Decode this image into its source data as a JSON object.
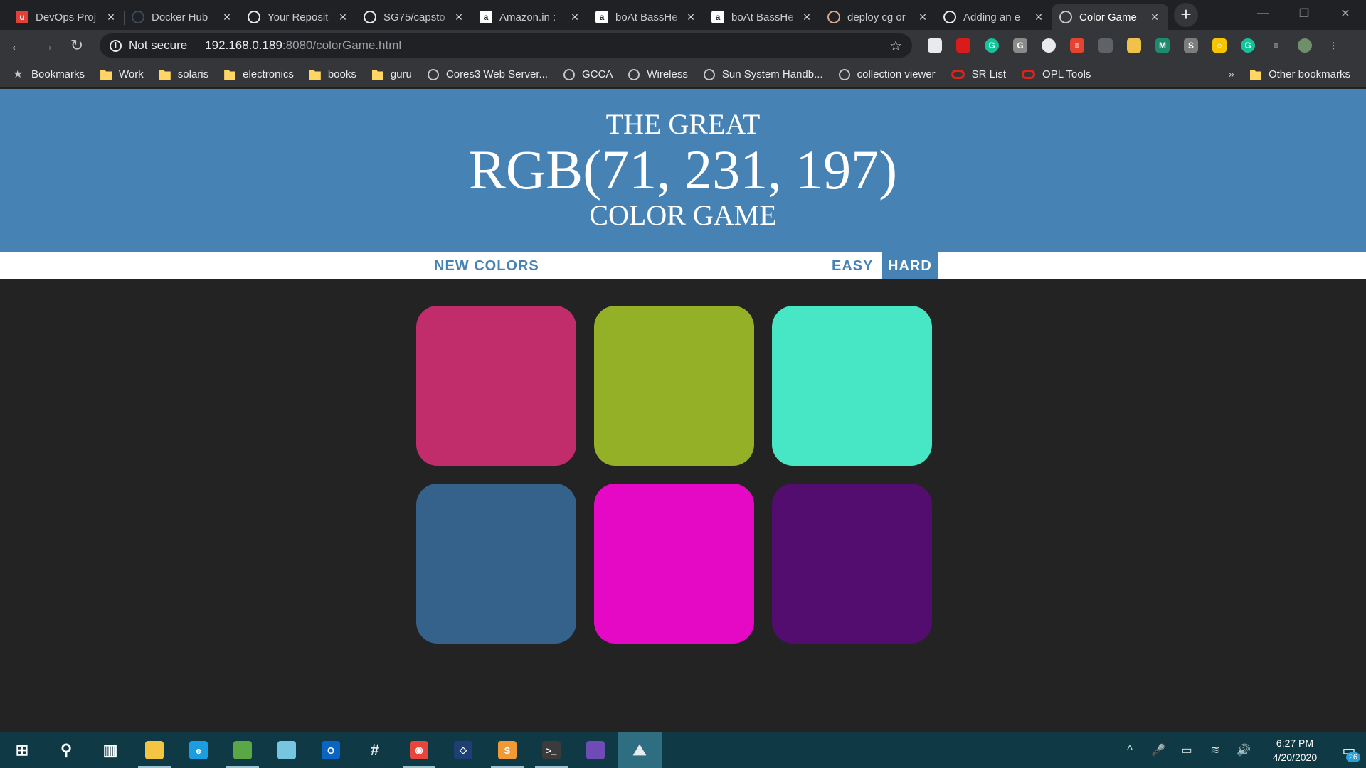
{
  "browser": {
    "tabs": [
      {
        "title": "DevOps Proj",
        "icon": "devops-icon",
        "color": "#e4403a",
        "glyph": "u"
      },
      {
        "title": "Docker Hub",
        "icon": "docker-icon",
        "color": "#3a4a5a",
        "glyph": ""
      },
      {
        "title": "Your Reposit",
        "icon": "github-icon",
        "color": "#e8eaed",
        "glyph": ""
      },
      {
        "title": "SG75/capsto",
        "icon": "github-icon",
        "color": "#e8eaed",
        "glyph": ""
      },
      {
        "title": "Amazon.in :",
        "icon": "amazon-icon",
        "color": "#ffffff",
        "glyph": "a"
      },
      {
        "title": "boAt BassHe",
        "icon": "amazon-icon",
        "color": "#ffffff",
        "glyph": "a"
      },
      {
        "title": "boAt BassHe",
        "icon": "amazon-icon",
        "color": "#ffffff",
        "glyph": "a"
      },
      {
        "title": "deploy cg or",
        "icon": "avatar-icon",
        "color": "#d9a78a",
        "glyph": ""
      },
      {
        "title": "Adding an e",
        "icon": "github-icon",
        "color": "#e8eaed",
        "glyph": ""
      },
      {
        "title": "Color Game",
        "icon": "globe-icon",
        "color": "#c4c6c9",
        "glyph": "",
        "active": true
      }
    ],
    "new_tab": "+",
    "window_controls": [
      "—",
      "❐",
      "✕"
    ],
    "nav": {
      "back": "←",
      "forward": "→",
      "reload": "↻"
    },
    "address": {
      "security": "Not secure",
      "host": "192.168.0.189",
      "path": ":8080/colorGame.html",
      "bookmark_star": "☆"
    },
    "extensions": [
      {
        "icon": "shield-ext-icon",
        "color": "#e8eaed",
        "glyph": ""
      },
      {
        "icon": "red-warning-ext-icon",
        "color": "#d81b1b",
        "glyph": ""
      },
      {
        "icon": "grammarly-ext-icon",
        "color": "#15c39a",
        "glyph": "G"
      },
      {
        "icon": "g-ext-icon",
        "color": "#8a8a8a",
        "glyph": "G"
      },
      {
        "icon": "circle-ext-icon",
        "color": "#e8eaed",
        "glyph": ""
      },
      {
        "icon": "todoist-ext-icon",
        "color": "#e44332",
        "glyph": "≡"
      },
      {
        "icon": "gray-ext-icon",
        "color": "#5f6368",
        "glyph": ""
      },
      {
        "icon": "note-ext-icon",
        "color": "#f0c24b",
        "glyph": ""
      },
      {
        "icon": "m-ext-icon",
        "color": "#1e8a6e",
        "glyph": "M"
      },
      {
        "icon": "s-ext-icon",
        "color": "#7c7c7c",
        "glyph": "S"
      },
      {
        "icon": "bulb-ext-icon",
        "color": "#f6c500",
        "glyph": "○"
      },
      {
        "icon": "grammarly-badge-ext-icon",
        "color": "#15c39a",
        "glyph": "G"
      },
      {
        "icon": "reading-list-icon",
        "color": "#c4c6c9",
        "glyph": "≡"
      },
      {
        "icon": "profile-avatar-icon",
        "color": "#6f8f6a",
        "glyph": ""
      },
      {
        "icon": "menu-kebab-icon",
        "color": "#c4c6c9",
        "glyph": "⋮"
      }
    ],
    "bookmarks": [
      {
        "label": "Bookmarks",
        "icon": "star"
      },
      {
        "label": "Work",
        "icon": "folder"
      },
      {
        "label": "solaris",
        "icon": "folder"
      },
      {
        "label": "electronics",
        "icon": "folder"
      },
      {
        "label": "books",
        "icon": "folder"
      },
      {
        "label": "guru",
        "icon": "folder"
      },
      {
        "label": "Cores3 Web Server...",
        "icon": "globe"
      },
      {
        "label": "GCCA",
        "icon": "globe"
      },
      {
        "label": "Wireless",
        "icon": "globe"
      },
      {
        "label": "Sun System Handb...",
        "icon": "globe"
      },
      {
        "label": "collection viewer",
        "icon": "globe"
      },
      {
        "label": "SR List",
        "icon": "oracle"
      },
      {
        "label": "OPL Tools",
        "icon": "oracle"
      }
    ],
    "bookmarks_overflow": "»",
    "other_bookmarks": "Other bookmarks"
  },
  "game": {
    "title_line1": "THE GREAT",
    "rgb_display": "RGB(71, 231, 197)",
    "title_line3": "COLOR GAME",
    "new_colors_label": "NEW COLORS",
    "easy_label": "EASY",
    "hard_label": "HARD",
    "selected_mode": "hard",
    "header_color": "#4682b4",
    "background_color": "#232323",
    "squares": [
      "#c02d6a",
      "#94b027",
      "#47e7c5",
      "#35628b",
      "#e508c5",
      "#520d6e"
    ]
  },
  "taskbar": {
    "apps": [
      {
        "icon": "windows-start-icon",
        "color": "#ffffff",
        "glyph": "⊞"
      },
      {
        "icon": "search-icon",
        "color": "#ffffff",
        "glyph": "⚲"
      },
      {
        "icon": "task-view-icon",
        "color": "#ffffff",
        "glyph": "▥"
      },
      {
        "icon": "file-explorer-icon",
        "color": "#f4c542",
        "glyph": "",
        "running": true
      },
      {
        "icon": "edge-icon",
        "color": "#1b9de2",
        "glyph": "e"
      },
      {
        "icon": "image-viewer-icon",
        "color": "#5aa845",
        "glyph": "",
        "running": true
      },
      {
        "icon": "notepad-icon",
        "color": "#77c6e0",
        "glyph": ""
      },
      {
        "icon": "outlook-icon",
        "color": "#0a64c2",
        "glyph": "O"
      },
      {
        "icon": "slack-icon",
        "color": "#e8eaed",
        "glyph": "#"
      },
      {
        "icon": "chrome-icon",
        "color": "#e8453c",
        "glyph": "◉",
        "running": true
      },
      {
        "icon": "virtualbox-icon",
        "color": "#1e3f73",
        "glyph": "◇"
      },
      {
        "icon": "sublime-text-icon",
        "color": "#f09a36",
        "glyph": "S",
        "running": true
      },
      {
        "icon": "terminal-icon",
        "color": "#3b3b3b",
        "glyph": ">_",
        "running": true
      },
      {
        "icon": "github-desktop-icon",
        "color": "#6e4bb5",
        "glyph": ""
      },
      {
        "icon": "photos-icon",
        "color": "#e8eaed",
        "glyph": "⛰",
        "active": true
      }
    ],
    "tray": {
      "chevron": "^",
      "mic": "🎤",
      "battery": "▭",
      "wifi": "≋",
      "volume": "🔊",
      "time": "6:27 PM",
      "date": "4/20/2020",
      "notifications_count": "26"
    }
  }
}
